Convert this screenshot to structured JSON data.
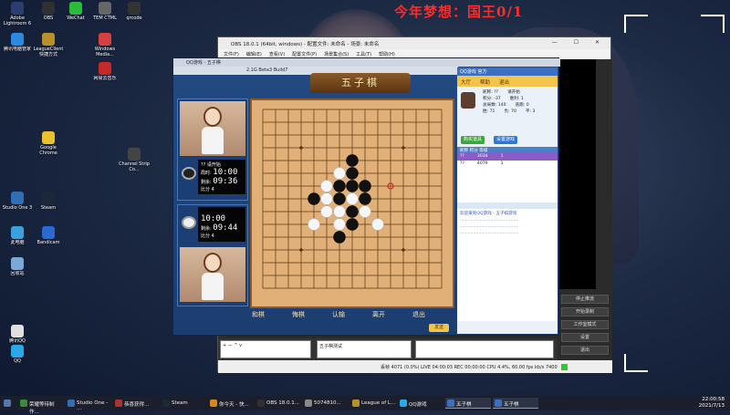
{
  "overlay_title": "今年梦想：国王0/1",
  "desktop_icons": [
    {
      "label": "Adobe Lightroom 6",
      "color": "#2c3e70"
    },
    {
      "label": "OBS",
      "color": "#303030"
    },
    {
      "label": "WeChat",
      "color": "#2dbb3d"
    },
    {
      "label": "TEM CTML",
      "color": "#666"
    },
    {
      "label": "qrcode",
      "color": "#333"
    },
    {
      "label": "腾讯电脑管家",
      "color": "#2a8ae0"
    },
    {
      "label": "LeagueClient 快捷方式",
      "color": "#b8902a"
    },
    {
      "label": "Windows Media...",
      "color": "#d84040"
    },
    {
      "label": "网易云音乐",
      "color": "#c8282a"
    },
    {
      "label": "Bandicam",
      "color": "#2a6ad0"
    },
    {
      "label": "此电脑",
      "color": "#3aa0e0"
    },
    {
      "label": "Channel Strip Co...",
      "color": "#444"
    },
    {
      "label": "Google Chrome",
      "color": "#e8c030"
    },
    {
      "label": "Steam",
      "color": "#1b2838"
    },
    {
      "label": "Studio One 3",
      "color": "#2e6fb5"
    },
    {
      "label": "回收站",
      "color": "#7aa8d8"
    },
    {
      "label": "QQ",
      "color": "#2aa8e8"
    },
    {
      "label": "腾讯QQ",
      "color": "#e0e0e0"
    }
  ],
  "obs": {
    "title": "OBS 18.0.1 (64bit, windows) - 配置文件: 未命名 - 场景: 未命名",
    "menu": [
      "文件(F)",
      "编辑(E)",
      "查看(V)",
      "配置文件(P)",
      "场景集合(S)",
      "工具(T)",
      "帮助(H)"
    ],
    "side_buttons": [
      "停止推流",
      "开始录制",
      "工作室模式",
      "设置",
      "退出"
    ],
    "bottom_left": "+ — ^ v",
    "scene_item": "五子棋测试",
    "status": "丢帧 4071 (0.0%)   LIVE 04:00:03   REC 00:00:00   CPU 4.4%, 60.00 fps   kb/s 7400"
  },
  "game": {
    "title": "QQ游戏 - 五子棋",
    "subtitle": "2.1G Beta3 Build7",
    "banner": "五子棋",
    "player_top": {
      "name": "??",
      "status": "请开始",
      "label1": "局时:",
      "time1": "10:00",
      "label2": "剩余:",
      "time2": "09:36",
      "score": "比分 4"
    },
    "player_bottom": {
      "time1": "10:00",
      "label2": "剩余:",
      "time2": "09:44",
      "score": "比分 4"
    },
    "tabs": [
      "和棋",
      "悔棋",
      "认输",
      "离开",
      "退出"
    ],
    "send": "发送"
  },
  "right_panel": {
    "top_label": "QQ游戏 官方",
    "menu": [
      "大厅",
      "帮助",
      "退出"
    ],
    "stats": [
      [
        "昵称: ??",
        "请开始"
      ],
      [
        "积分: -37",
        "胜利: 1"
      ],
      [
        "总局数: 140",
        "逃跑: 0"
      ],
      [
        "胜: 71",
        "负: 70",
        "平: 3"
      ]
    ],
    "buttons": [
      "购买道具",
      "设置游戏"
    ],
    "table_header": "昵称  积分  等级",
    "rows": [
      {
        "name": "??",
        "score": "3034",
        "level": "1"
      },
      {
        "name": "??",
        "score": "4079",
        "level": "1"
      }
    ],
    "chat": [
      "欢迎来到QQ游戏 - 五子棋游戏",
      "............................................",
      "............................................",
      "............................................"
    ]
  },
  "taskbar": {
    "items": [
      {
        "label": "荣耀等待制作...",
        "color": "#3a8a3a"
      },
      {
        "label": "Studio One - ...",
        "color": "#2e6fb5"
      },
      {
        "label": "恭喜获得...",
        "color": "#aa3333"
      },
      {
        "label": "Steam",
        "color": "#1b2838"
      },
      {
        "label": "你今天 - 快...",
        "color": "#d08a20"
      },
      {
        "label": "OBS 18.0.1...",
        "color": "#303030"
      },
      {
        "label": "5074810...",
        "color": "#888"
      },
      {
        "label": "League of L...",
        "color": "#b8902a"
      },
      {
        "label": "QQ游戏",
        "color": "#2aa8e8"
      },
      {
        "label": "五子棋",
        "color": "#3c6fc0"
      },
      {
        "label": "五子棋",
        "color": "#3c6fc0"
      }
    ],
    "time": "22:00:58",
    "date": "2021/7/13"
  },
  "board": {
    "grid": 15,
    "stones": [
      {
        "col": 7,
        "row": 4,
        "color": "black"
      },
      {
        "col": 6,
        "row": 5,
        "color": "white"
      },
      {
        "col": 7,
        "row": 5,
        "color": "black"
      },
      {
        "col": 5,
        "row": 6,
        "color": "white"
      },
      {
        "col": 6,
        "row": 6,
        "color": "black"
      },
      {
        "col": 7,
        "row": 6,
        "color": "black"
      },
      {
        "col": 8,
        "row": 6,
        "color": "black"
      },
      {
        "col": 4,
        "row": 7,
        "color": "black"
      },
      {
        "col": 5,
        "row": 7,
        "color": "white"
      },
      {
        "col": 6,
        "row": 7,
        "color": "black"
      },
      {
        "col": 7,
        "row": 7,
        "color": "white"
      },
      {
        "col": 8,
        "row": 7,
        "color": "black"
      },
      {
        "col": 5,
        "row": 8,
        "color": "white"
      },
      {
        "col": 6,
        "row": 8,
        "color": "white"
      },
      {
        "col": 7,
        "row": 8,
        "color": "black"
      },
      {
        "col": 8,
        "row": 8,
        "color": "white"
      },
      {
        "col": 4,
        "row": 9,
        "color": "white"
      },
      {
        "col": 6,
        "row": 9,
        "color": "white"
      },
      {
        "col": 7,
        "row": 9,
        "color": "black"
      },
      {
        "col": 9,
        "row": 9,
        "color": "white"
      },
      {
        "col": 6,
        "row": 10,
        "color": "black"
      }
    ],
    "marker": {
      "col": 10,
      "row": 6
    }
  }
}
